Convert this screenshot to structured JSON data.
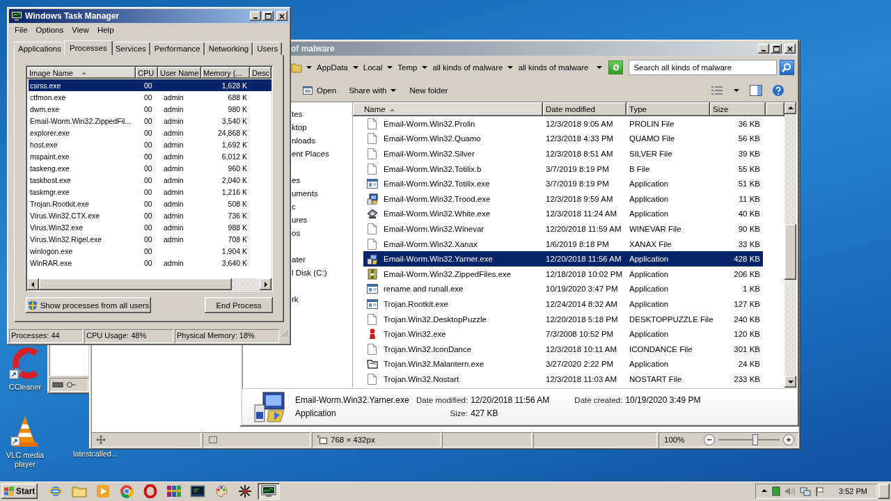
{
  "desktop_icons": [
    {
      "label": "CCleaner",
      "kind": "ccleaner"
    },
    {
      "label": "VLC media player",
      "kind": "vlc"
    },
    {
      "label": "latestcalled...",
      "kind": "covered"
    }
  ],
  "paint_window": {
    "status_bar": {
      "dimensions": "768 × 432px",
      "zoom": "100%",
      "level": 0.6
    }
  },
  "explorer": {
    "title": "of malware",
    "breadcrumb": [
      "AppData",
      "Local",
      "Temp",
      "all kinds of malware",
      "all kinds of malware"
    ],
    "search": {
      "placeholder": "Search all kinds of malware"
    },
    "toolbar": [
      {
        "label": "Open",
        "kind": "open"
      },
      {
        "label": "Share with",
        "kind": "menu"
      },
      {
        "label": "New folder",
        "kind": "plain"
      }
    ],
    "nav_groups": [
      {
        "items": [
          "tes",
          "ktop",
          "nloads",
          "ent Places"
        ]
      },
      {
        "items": [
          "es",
          "uments",
          "c",
          "ures",
          "os"
        ]
      },
      {
        "items": [
          "ater",
          "l Disk (C:)"
        ]
      },
      {
        "items": [
          "rk"
        ]
      }
    ],
    "columns": [
      {
        "label": "Name",
        "sorted": true
      },
      {
        "label": "Date modified",
        "sorted": false
      },
      {
        "label": "Type",
        "sorted": false
      },
      {
        "label": "Size",
        "sorted": false
      }
    ],
    "files": [
      {
        "name": "Email-Worm.Win32.Prolin",
        "date": "12/3/2018 9:05 AM",
        "type": "PROLIN File",
        "size": "36 KB",
        "kind": "document",
        "selected": false
      },
      {
        "name": "Email-Worm.Win32.Quamo",
        "date": "12/3/2018 4:33 PM",
        "type": "QUAMO File",
        "size": "56 KB",
        "kind": "document",
        "selected": false
      },
      {
        "name": "Email-Worm.Win32.Silver",
        "date": "12/3/2018 8:51 AM",
        "type": "SILVER File",
        "size": "39 KB",
        "kind": "document",
        "selected": false
      },
      {
        "name": "Email-Worm.Win32.Totilix.b",
        "date": "3/7/2019 8:19 PM",
        "type": "B File",
        "size": "55 KB",
        "kind": "document",
        "selected": false
      },
      {
        "name": "Email-Worm.Win32.Totilix.exe",
        "date": "3/7/2019 8:19 PM",
        "type": "Application",
        "size": "51 KB",
        "kind": "window",
        "selected": false
      },
      {
        "name": "Email-Worm.Win32.Trood.exe",
        "date": "12/3/2018 9:59 AM",
        "type": "Application",
        "size": "11 KB",
        "kind": "setup",
        "selected": false
      },
      {
        "name": "Email-Worm.Win32.White.exe",
        "date": "12/3/2018 11:24 AM",
        "type": "Application",
        "size": "40 KB",
        "kind": "device",
        "selected": false
      },
      {
        "name": "Email-Worm.Win32.Winevar",
        "date": "12/20/2018 11:59 AM",
        "type": "WINEVAR File",
        "size": "90 KB",
        "kind": "document",
        "selected": false
      },
      {
        "name": "Email-Worm.Win32.Xanax",
        "date": "1/6/2019 8:18 PM",
        "type": "XANAX File",
        "size": "33 KB",
        "kind": "document",
        "selected": false
      },
      {
        "name": "Email-Worm.Win32.Yarner.exe",
        "date": "12/20/2018 11:56 AM",
        "type": "Application",
        "size": "428 KB",
        "kind": "setup",
        "selected": true
      },
      {
        "name": "Email-Worm.Win32.ZippedFiles.exe",
        "date": "12/18/2018 10:02 PM",
        "type": "Application",
        "size": "206 KB",
        "kind": "archive",
        "selected": false
      },
      {
        "name": "rename and runall.exe",
        "date": "10/19/2020 3:47 PM",
        "type": "Application",
        "size": "1 KB",
        "kind": "window",
        "selected": false
      },
      {
        "name": "Trojan.Rootkit.exe",
        "date": "12/24/2014 8:32 AM",
        "type": "Application",
        "size": "127 KB",
        "kind": "window",
        "selected": false
      },
      {
        "name": "Trojan.Win32.DesktopPuzzle",
        "date": "12/20/2018 5:18 PM",
        "type": "DESKTOPPUZZLE File",
        "size": "240 KB",
        "kind": "document",
        "selected": false
      },
      {
        "name": "Trojan.Win32.exe",
        "date": "7/3/2008 10:52 PM",
        "type": "Application",
        "size": "120 KB",
        "kind": "figure",
        "selected": false
      },
      {
        "name": "Trojan.Win32.IconDance",
        "date": "12/3/2018 10:11 AM",
        "type": "ICONDANCE File",
        "size": "301 KB",
        "kind": "document",
        "selected": false
      },
      {
        "name": "Trojan.Win32.Malantern.exe",
        "date": "3/27/2020 2:22 PM",
        "type": "Application",
        "size": "24 KB",
        "kind": "frame",
        "selected": false
      },
      {
        "name": "Trojan.Win32.Nostart",
        "date": "12/3/2018 11:03 AM",
        "type": "NOSTART File",
        "size": "233 KB",
        "kind": "document",
        "selected": false
      }
    ],
    "details": {
      "name": "Email-Worm.Win32.Yarner.exe",
      "type": "Application",
      "fields": [
        {
          "label": "Date modified:",
          "value": "12/20/2018 11:56 AM"
        },
        {
          "label": "Date created:",
          "value": "10/19/2020 3:49 PM"
        },
        {
          "label": "Size:",
          "value": "427 KB"
        }
      ]
    }
  },
  "task_manager": {
    "title": "Windows Task Manager",
    "menu": [
      "File",
      "Options",
      "View",
      "Help"
    ],
    "tabs": [
      {
        "label": "Applications",
        "selected": false
      },
      {
        "label": "Processes",
        "selected": true
      },
      {
        "label": "Services",
        "selected": false
      },
      {
        "label": "Performance",
        "selected": false
      },
      {
        "label": "Networking",
        "selected": false
      },
      {
        "label": "Users",
        "selected": false
      }
    ],
    "columns": [
      {
        "label": "Image Name",
        "sorted": true
      },
      {
        "label": "CPU",
        "sorted": false
      },
      {
        "label": "User Name",
        "sorted": false
      },
      {
        "label": "Memory (...",
        "sorted": false
      },
      {
        "label": "Desc",
        "sorted": false
      }
    ],
    "processes": [
      {
        "name": "csrss.exe",
        "cpu": "00",
        "memory": "1,628 K",
        "selected": true
      },
      {
        "name": "ctfmon.exe",
        "cpu": "00",
        "user": "admin",
        "memory": "688 K",
        "selected": false
      },
      {
        "name": "dwm.exe",
        "cpu": "00",
        "user": "admin",
        "memory": "980 K",
        "selected": false
      },
      {
        "name": "Email-Worm.Win32.ZippedFil...",
        "cpu": "00",
        "user": "admin",
        "memory": "3,540 K",
        "selected": false
      },
      {
        "name": "explorer.exe",
        "cpu": "00",
        "user": "admin",
        "memory": "24,868 K",
        "selected": false
      },
      {
        "name": "host.exe",
        "cpu": "00",
        "user": "admin",
        "memory": "1,692 K",
        "selected": false
      },
      {
        "name": "mspaint.exe",
        "cpu": "00",
        "user": "admin",
        "memory": "6,012 K",
        "selected": false
      },
      {
        "name": "taskeng.exe",
        "cpu": "00",
        "user": "admin",
        "memory": "960 K",
        "selected": false
      },
      {
        "name": "taskhost.exe",
        "cpu": "00",
        "user": "admin",
        "memory": "2,040 K",
        "selected": false
      },
      {
        "name": "taskmgr.exe",
        "cpu": "00",
        "user": "admin",
        "memory": "1,216 K",
        "selected": false
      },
      {
        "name": "Trojan.Rootkit.exe",
        "cpu": "00",
        "user": "admin",
        "memory": "508 K",
        "selected": false
      },
      {
        "name": "Virus.Win32.CTX.exe",
        "cpu": "00",
        "user": "admin",
        "memory": "736 K",
        "selected": false
      },
      {
        "name": "Virus.Win32.exe",
        "cpu": "00",
        "user": "admin",
        "memory": "988 K",
        "selected": false
      },
      {
        "name": "Virus.Win32.Rigel.exe",
        "cpu": "00",
        "user": "admin",
        "memory": "708 K",
        "selected": false
      },
      {
        "name": "winlogon.exe",
        "cpu": "00",
        "memory": "1,904 K",
        "selected": false
      },
      {
        "name": "WinRAR.exe",
        "cpu": "00",
        "user": "admin",
        "memory": "3,640 K",
        "selected": false
      }
    ],
    "buttons": [
      {
        "label": "Show processes from all users",
        "kind": "shield"
      },
      {
        "label": "End Process",
        "kind": "plain"
      }
    ],
    "status": [
      "Processes: 44",
      "CPU Usage: 48%",
      "Physical Memory: 18%"
    ]
  },
  "taskbar": {
    "start": "Start",
    "apps": [
      {
        "kind": "ie",
        "selected": false
      },
      {
        "kind": "folder",
        "selected": false
      },
      {
        "kind": "media",
        "selected": false
      },
      {
        "kind": "chrome",
        "selected": false
      },
      {
        "kind": "opera",
        "selected": false
      },
      {
        "kind": "winrar",
        "selected": false
      },
      {
        "kind": "terminal",
        "selected": false
      },
      {
        "kind": "paint",
        "selected": false
      },
      {
        "kind": "asterisk",
        "selected": false
      },
      {
        "kind": "taskmgr",
        "selected": true
      }
    ],
    "clock": "3:52 PM"
  }
}
